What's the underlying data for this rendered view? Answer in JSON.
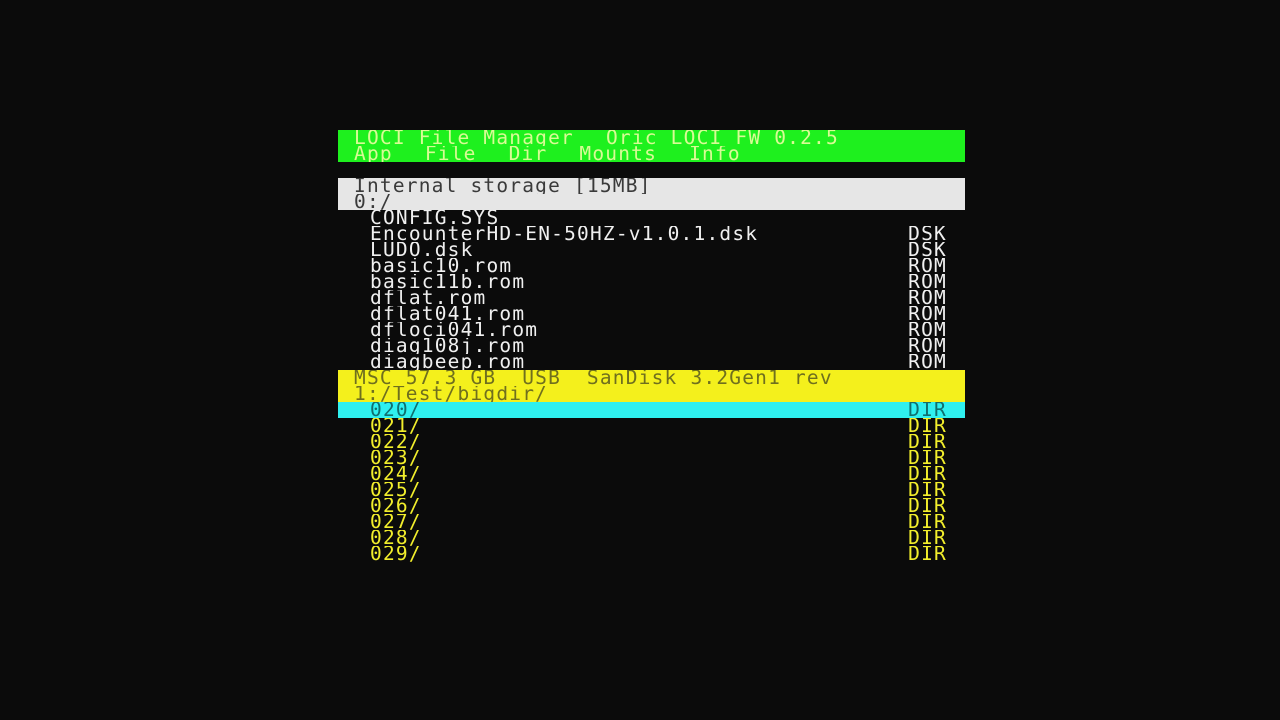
{
  "header": {
    "title": "LOCI File Manager",
    "firmware": "Oric LOCI FW 0.2.5",
    "menu": [
      "App",
      "File",
      "Dir",
      "Mounts",
      "Info"
    ]
  },
  "internal": {
    "name": "Internal storage [15MB]",
    "path": "0:/",
    "files": [
      {
        "name": "CONFIG.SYS",
        "type": ""
      },
      {
        "name": "EncounterHD-EN-50HZ-v1.0.1.dsk",
        "type": "DSK"
      },
      {
        "name": "LUDO.dsk",
        "type": "DSK"
      },
      {
        "name": "basic10.rom",
        "type": "ROM"
      },
      {
        "name": "basic11b.rom",
        "type": "ROM"
      },
      {
        "name": "dflat.rom",
        "type": "ROM"
      },
      {
        "name": "dflat041.rom",
        "type": "ROM"
      },
      {
        "name": "dfloci041.rom",
        "type": "ROM"
      },
      {
        "name": "diag108j.rom",
        "type": "ROM"
      },
      {
        "name": "diagbeep.rom",
        "type": "ROM"
      }
    ]
  },
  "usb": {
    "name": "MSC 57.3 GB  USB  SanDisk 3.2Gen1 rev",
    "path": "1:/Test/bigdir/",
    "files": [
      {
        "name": "020/",
        "type": "DIR",
        "selected": true
      },
      {
        "name": "021/",
        "type": "DIR"
      },
      {
        "name": "022/",
        "type": "DIR"
      },
      {
        "name": "023/",
        "type": "DIR"
      },
      {
        "name": "024/",
        "type": "DIR"
      },
      {
        "name": "025/",
        "type": "DIR"
      },
      {
        "name": "026/",
        "type": "DIR"
      },
      {
        "name": "027/",
        "type": "DIR"
      },
      {
        "name": "028/",
        "type": "DIR"
      },
      {
        "name": "029/",
        "type": "DIR"
      }
    ]
  },
  "colors": {
    "header_bg": "#1ef01e",
    "internal_bg": "#e6e6e6",
    "usb_bg": "#f4f01c",
    "selection_bg": "#2ff0ef",
    "screen_bg": "#0b0b0b"
  }
}
